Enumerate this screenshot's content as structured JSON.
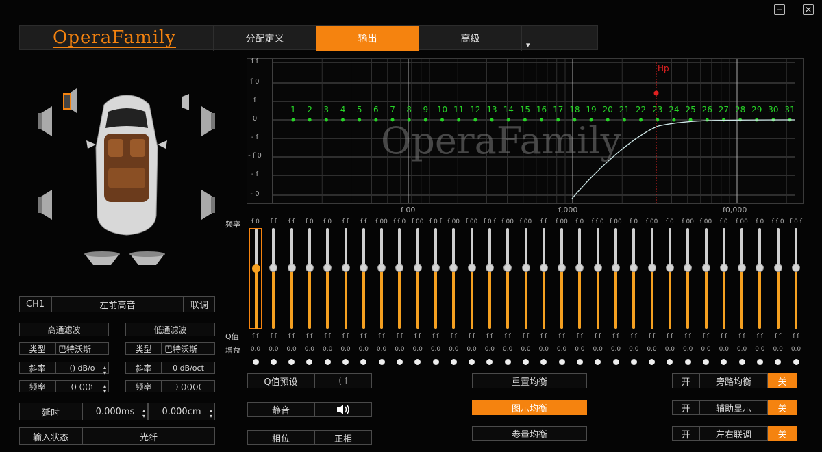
{
  "window": {
    "minimize": "−",
    "close": "✕"
  },
  "nav": {
    "logo": "OperaFamily",
    "tabs": [
      "分配定义",
      "输出",
      "高级"
    ],
    "active_tab": "输出",
    "dropdown_icon": "▾"
  },
  "graph": {
    "y_labels": [
      "ſ ſ",
      "ſ 0",
      "ſ",
      "0",
      "- ſ",
      "- ſ 0",
      "- ſ",
      "- 0"
    ],
    "x_labels": [
      "ſ 00",
      "ſ,000",
      "ſ0,000"
    ],
    "hp_label": "Hp",
    "band_numbers": [
      "1",
      "2",
      "3",
      "4",
      "5",
      "6",
      "7",
      "8",
      "9",
      "10",
      "11",
      "12",
      "13",
      "14",
      "15",
      "16",
      "17",
      "18",
      "19",
      "20",
      "21",
      "22",
      "23",
      "24",
      "25",
      "26",
      "27",
      "28",
      "29",
      "30",
      "31"
    ],
    "watermark": "OperaFamily"
  },
  "eq": {
    "freq_label": "频率",
    "q_label": "Q值",
    "gain_label": "增益",
    "freqs": [
      "ſ 0",
      "ſ ſ",
      "ſ ſ",
      "ſ 0",
      "ſ 0",
      "ſ ſ",
      "ſ ſ",
      "ſ 00",
      "ſ ſ 0",
      "ſ 00",
      "ſ 0 ſ",
      "ſ 00",
      "ſ 00",
      "ſ 0 ſ",
      "ſ 00",
      "ſ 00",
      "ſ ſ",
      "ſ 00",
      "ſ 0",
      "ſ ſ 0",
      "ſ 00",
      "ſ 0",
      "ſ 00",
      "ſ 0",
      "ſ 00",
      "ſ 00",
      "ſ 0",
      "ſ 00",
      "ſ 0",
      "ſ ſ 0",
      "ſ 0 ſ"
    ],
    "q_values": [
      "ſ ſ",
      "ſ ſ",
      "ſ ſ",
      "ſ ſ",
      "ſ ſ",
      "ſ ſ",
      "ſ ſ",
      "ſ ſ",
      "ſ ſ",
      "ſ ſ",
      "ſ ſ",
      "ſ ſ",
      "ſ ſ",
      "ſ ſ",
      "ſ ſ",
      "ſ ſ",
      "ſ ſ",
      "ſ ſ",
      "ſ ſ",
      "ſ ſ",
      "ſ ſ",
      "ſ ſ",
      "ſ ſ",
      "ſ ſ",
      "ſ ſ",
      "ſ ſ",
      "ſ ſ",
      "ſ ſ",
      "ſ ſ",
      "ſ ſ",
      "ſ ſ"
    ],
    "gains": [
      "0.0",
      "0.0",
      "0.0",
      "0.0",
      "0.0",
      "0.0",
      "0.0",
      "0.0",
      "0.0",
      "0.0",
      "0.0",
      "0.0",
      "0.0",
      "0.0",
      "0.0",
      "0.0",
      "0.0",
      "0.0",
      "0.0",
      "0.0",
      "0.0",
      "0.0",
      "0.0",
      "0.0",
      "0.0",
      "0.0",
      "0.0",
      "0.0",
      "0.0",
      "0.0",
      "0.0"
    ],
    "selected_band": 1
  },
  "channel": {
    "id": "CH1",
    "name": "左前高音",
    "link": "联调"
  },
  "hpf": {
    "title": "高通滤波",
    "type_label": "类型",
    "type_value": "巴特沃斯",
    "slope_label": "斜率",
    "slope_value": "() dB/o",
    "freq_label": "频率",
    "freq_value": "() ()()ſ"
  },
  "lpf": {
    "title": "低通滤波",
    "type_label": "类型",
    "type_value": "巴特沃斯",
    "slope_label": "斜率",
    "slope_value": "0 dB/oct",
    "freq_label": "频率",
    "freq_value": ") ()()()("
  },
  "delay": {
    "label": "延时",
    "ms": "0.000ms",
    "cm": "0.000cm"
  },
  "input": {
    "label": "输入状态",
    "value": "光纤"
  },
  "controls": {
    "q_preset_label": "Q值预设",
    "q_preset_value": "( ſ",
    "mute_label": "静音",
    "mute_icon": "speaker-icon",
    "phase_label": "相位",
    "phase_value": "正相",
    "reset_eq": "重置均衡",
    "graphic_eq": "图示均衡",
    "param_eq": "参量均衡",
    "bypass": {
      "on": "开",
      "label": "旁路均衡",
      "off": "关"
    },
    "aux": {
      "on": "开",
      "label": "辅助显示",
      "off": "关"
    },
    "lr": {
      "on": "开",
      "label": "左右联调",
      "off": "关"
    }
  },
  "colors": {
    "accent": "#f5830f",
    "green": "#27d327",
    "hp": "#e02020"
  }
}
